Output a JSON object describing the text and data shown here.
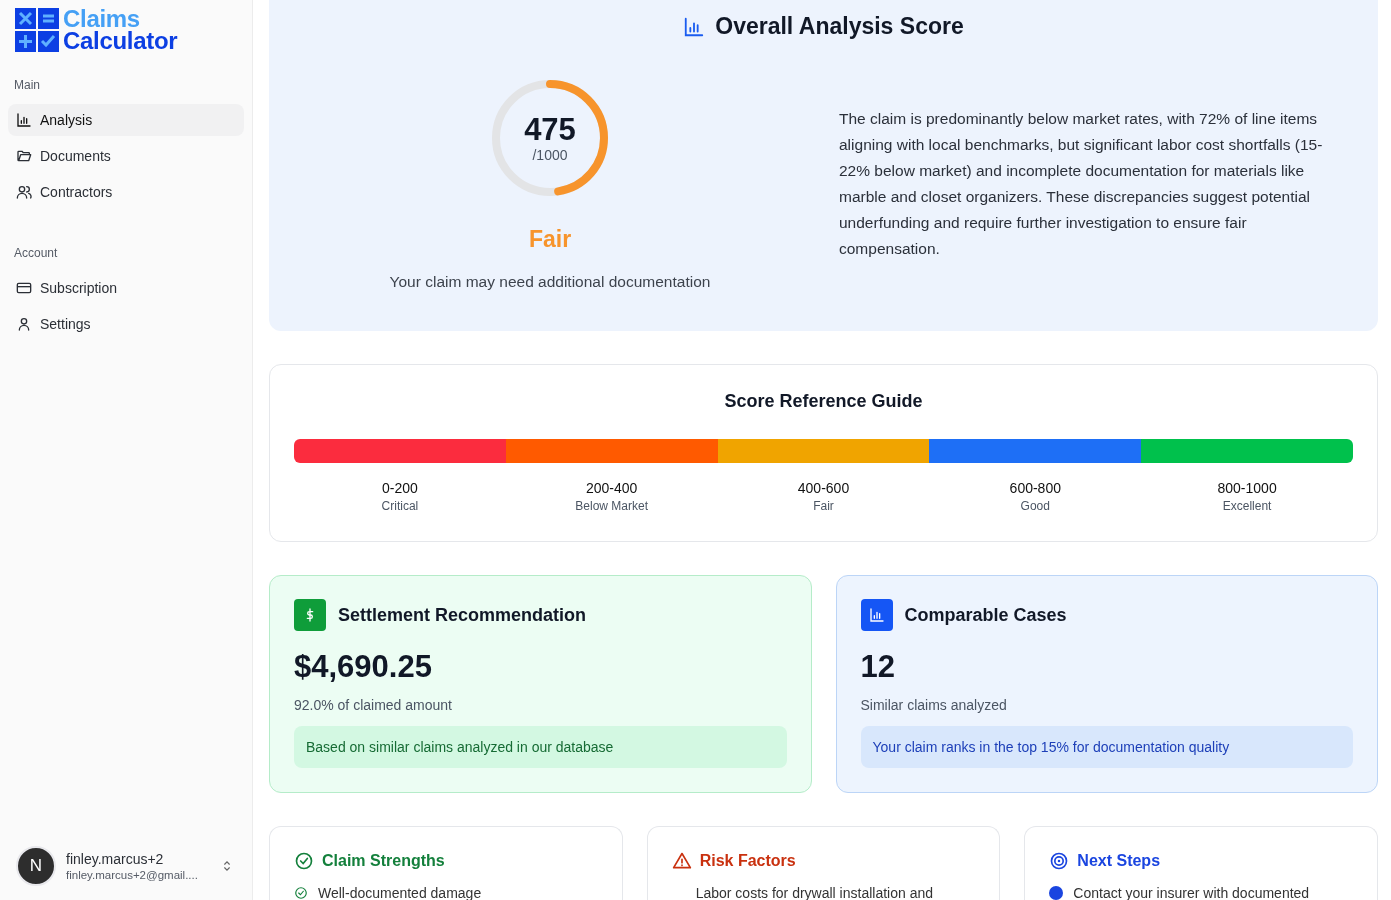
{
  "logo": {
    "line1": "Claims",
    "line2": "Calculator"
  },
  "sidebar": {
    "sections": [
      {
        "title": "Main",
        "items": [
          {
            "label": "Analysis",
            "kind": "chart",
            "selected": true
          },
          {
            "label": "Documents",
            "kind": "folder",
            "selected": false
          },
          {
            "label": "Contractors",
            "kind": "users",
            "selected": false
          }
        ]
      },
      {
        "title": "Account",
        "items": [
          {
            "label": "Subscription",
            "kind": "card",
            "selected": false
          },
          {
            "label": "Settings",
            "kind": "user",
            "selected": false
          }
        ]
      }
    ]
  },
  "user": {
    "initial": "N",
    "name": "finley.marcus+2",
    "email": "finley.marcus+2@gmail...."
  },
  "score": {
    "title": "Overall Analysis Score",
    "value": "475",
    "max": "/1000",
    "level": 0.475,
    "rating": "Fair",
    "note": "Your claim may need additional documentation",
    "summary": "The claim is predominantly below market rates, with 72% of line items aligning with local benchmarks, but significant labor cost shortfalls (15-22% below market) and incomplete documentation for materials like marble and closet organizers. These discrepancies suggest potential underfunding and require further investigation to ensure fair compensation."
  },
  "reference": {
    "title": "Score Reference Guide",
    "ranges": [
      {
        "range": "0-200",
        "label": "Critical",
        "color": "#fb2c3e"
      },
      {
        "range": "200-400",
        "label": "Below Market",
        "color": "#ff5a00"
      },
      {
        "range": "400-600",
        "label": "Fair",
        "color": "#f0a400"
      },
      {
        "range": "600-800",
        "label": "Good",
        "color": "#1e6ff6"
      },
      {
        "range": "800-1000",
        "label": "Excellent",
        "color": "#00c14c"
      }
    ]
  },
  "stats": [
    {
      "kind": "settlement",
      "title": "Settlement Recommendation",
      "value": "$4,690.25",
      "caption": "92.0% of claimed amount",
      "note": "Based on similar claims analyzed in our database"
    },
    {
      "kind": "comparable",
      "title": "Comparable Cases",
      "value": "12",
      "caption": "Similar claims analyzed",
      "note": "Your claim ranks in the top 15% for documentation quality"
    }
  ],
  "panels": [
    {
      "kind": "strengths",
      "title": "Claim Strengths",
      "items": [
        "Well-documented damage"
      ]
    },
    {
      "kind": "risks",
      "title": "Risk Factors",
      "items": [
        "Labor costs for drywall installation and"
      ]
    },
    {
      "kind": "steps",
      "title": "Next Steps",
      "items": [
        "Contact your insurer with documented"
      ]
    }
  ]
}
